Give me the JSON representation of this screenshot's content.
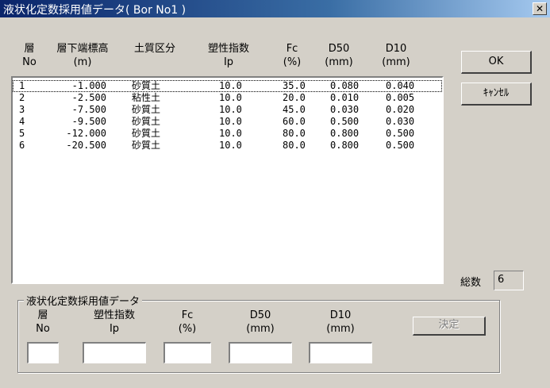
{
  "window": {
    "title": "液状化定数採用値データ( Bor No1 )",
    "close_glyph": "✕"
  },
  "headers": {
    "no": [
      "層",
      "No"
    ],
    "depth": [
      "層下端標高",
      "(m)"
    ],
    "soil": [
      "土質区分",
      ""
    ],
    "ip": [
      "塑性指数",
      "Ip"
    ],
    "fc": [
      "Fc",
      "(%)"
    ],
    "d50": [
      "D50",
      "(mm)"
    ],
    "d10": [
      "D10",
      "(mm)"
    ]
  },
  "rows": [
    {
      "no": "1",
      "depth": "-1.000",
      "soil": "砂質土",
      "ip": "10.0",
      "fc": "35.0",
      "d50": "0.080",
      "d10": "0.040"
    },
    {
      "no": "2",
      "depth": "-2.500",
      "soil": "粘性土",
      "ip": "10.0",
      "fc": "20.0",
      "d50": "0.010",
      "d10": "0.005"
    },
    {
      "no": "3",
      "depth": "-7.500",
      "soil": "砂質土",
      "ip": "10.0",
      "fc": "45.0",
      "d50": "0.030",
      "d10": "0.020"
    },
    {
      "no": "4",
      "depth": "-9.500",
      "soil": "砂質土",
      "ip": "10.0",
      "fc": "60.0",
      "d50": "0.500",
      "d10": "0.030"
    },
    {
      "no": "5",
      "depth": "-12.000",
      "soil": "砂質土",
      "ip": "10.0",
      "fc": "80.0",
      "d50": "0.800",
      "d10": "0.500"
    },
    {
      "no": "6",
      "depth": "-20.500",
      "soil": "砂質土",
      "ip": "10.0",
      "fc": "80.0",
      "d50": "0.800",
      "d10": "0.500"
    }
  ],
  "buttons": {
    "ok": "OK",
    "cancel": "ｷｬﾝｾﾙ",
    "decide": "決定"
  },
  "total": {
    "label": "総数",
    "value": "6"
  },
  "group": {
    "legend": "液状化定数採用値データ",
    "headers": {
      "no": [
        "層",
        "No"
      ],
      "ip": [
        "塑性指数",
        "Ip"
      ],
      "fc": [
        "Fc",
        "(%)"
      ],
      "d50": [
        "D50",
        "(mm)"
      ],
      "d10": [
        "D10",
        "(mm)"
      ]
    },
    "values": {
      "no": "",
      "ip": "",
      "fc": "",
      "d50": "",
      "d10": ""
    }
  }
}
